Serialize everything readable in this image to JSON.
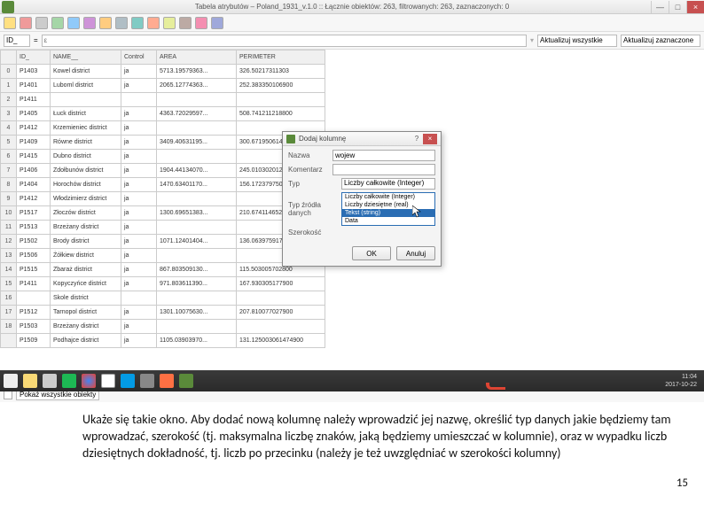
{
  "title_bar": {
    "text": "Tabela atrybutów – Poland_1931_v.1.0 :: Łącznie obiektów: 263, filtrowanych: 263, zaznaczonych: 0",
    "min": "—",
    "max": "□",
    "close": "×"
  },
  "expr_bar": {
    "field": "ID_",
    "op": "=",
    "expr_placeholder": "ε",
    "layout1": "Aktualizuj wszystkie",
    "layout2": "Aktualizuj zaznaczone"
  },
  "columns": [
    "ID_",
    "NAME__",
    "Control",
    "AREA",
    "PERIMETER"
  ],
  "rows": [
    {
      "n": "0",
      "id": "P1403",
      "name": "Kowel district",
      "ctrl": "ja",
      "area": "5713.19579363...",
      "perim": "326.50217311303"
    },
    {
      "n": "1",
      "id": "P1401",
      "name": "Luboml district",
      "ctrl": "ja",
      "area": "2065.12774363...",
      "perim": "252.383350106900"
    },
    {
      "n": "2",
      "id": "P1411",
      "name": "",
      "ctrl": "",
      "area": "",
      "perim": ""
    },
    {
      "n": "3",
      "id": "P1405",
      "name": "Łuck district",
      "ctrl": "ja",
      "area": "4363.72029597...",
      "perim": "508.741211218800"
    },
    {
      "n": "4",
      "id": "P1412",
      "name": "Krzemieniec district",
      "ctrl": "ja",
      "area": "",
      "perim": ""
    },
    {
      "n": "5",
      "id": "P1409",
      "name": "Równe district",
      "ctrl": "ja",
      "area": "3409.40631195...",
      "perim": "300.671950614900"
    },
    {
      "n": "6",
      "id": "P1415",
      "name": "Dubno district",
      "ctrl": "ja",
      "area": "",
      "perim": ""
    },
    {
      "n": "7",
      "id": "P1406",
      "name": "Zdołbunów district",
      "ctrl": "ja",
      "area": "1904.44134070...",
      "perim": "245.010302012500"
    },
    {
      "n": "8",
      "id": "P1404",
      "name": "Horochów district",
      "ctrl": "ja",
      "area": "1470.63401170...",
      "perim": "156.172379750500"
    },
    {
      "n": "9",
      "id": "P1412",
      "name": "Włodzimierz district",
      "ctrl": "ja",
      "area": "",
      "perim": ""
    },
    {
      "n": "10",
      "id": "P1517",
      "name": "Złoczów district",
      "ctrl": "ja",
      "area": "1300.69651383...",
      "perim": "210.674114652900"
    },
    {
      "n": "11",
      "id": "P1513",
      "name": "Brzeżany district",
      "ctrl": "ja",
      "area": "",
      "perim": ""
    },
    {
      "n": "12",
      "id": "P1502",
      "name": "Brody district",
      "ctrl": "ja",
      "area": "1071.12401404...",
      "perim": "136.063975917200"
    },
    {
      "n": "13",
      "id": "P1506",
      "name": "Żółkiew district",
      "ctrl": "ja",
      "area": "",
      "perim": ""
    },
    {
      "n": "14",
      "id": "P1515",
      "name": "Zbaraż district",
      "ctrl": "ja",
      "area": "867.803509130...",
      "perim": "115.503005702800"
    },
    {
      "n": "15",
      "id": "P1411",
      "name": "Kopyczyńce district",
      "ctrl": "ja",
      "area": "971.803611390...",
      "perim": "167.930305177900"
    },
    {
      "n": "16",
      "id": "",
      "name": "Skole district",
      "ctrl": "",
      "area": "",
      "perim": ""
    },
    {
      "n": "17",
      "id": "P1512",
      "name": "Tarnopol district",
      "ctrl": "ja",
      "area": "1301.10075630...",
      "perim": "207.810077027900"
    },
    {
      "n": "18",
      "id": "P1503",
      "name": "Brzeżany district",
      "ctrl": "ja",
      "area": "",
      "perim": ""
    },
    {
      "n": "",
      "id": "P1509",
      "name": "Podhajce district",
      "ctrl": "ja",
      "area": "1105.03903970...",
      "perim": "131.125003061474900"
    }
  ],
  "bottom_bar": {
    "show_label": "Pokaż wszystkie obiekty"
  },
  "dialog": {
    "title": "Dodaj kolumnę",
    "help": "?",
    "close": "×",
    "name_label": "Nazwa",
    "name_value": "wojew",
    "comment_label": "Komentarz",
    "type_label": "Typ",
    "type_value": "Liczby całkowite (Integer)",
    "source_label": "Typ źródła danych",
    "width_label": "Szerokość",
    "options": [
      "Liczby całkowite (Integer)",
      "Liczby dziesiętne (real)",
      "Tekst (string)",
      "Data"
    ],
    "selected_option_index": 2,
    "ok": "OK",
    "cancel": "Anuluj"
  },
  "taskbar": {
    "time": "11:04",
    "date": "2017-10-22"
  },
  "caption": "Ukaże się takie okno. Aby dodać nową kolumnę należy wprowadzić jej nazwę, określić typ danych jakie będziemy tam wprowadzać, szerokość (tj. maksymalna liczbę znaków, jaką będziemy umieszczać w kolumnie), oraz w wypadku liczb dziesiętnych dokładność, tj. liczb po przecinku (należy je też uwzględniać w szerokości kolumny)",
  "page_num": "15"
}
